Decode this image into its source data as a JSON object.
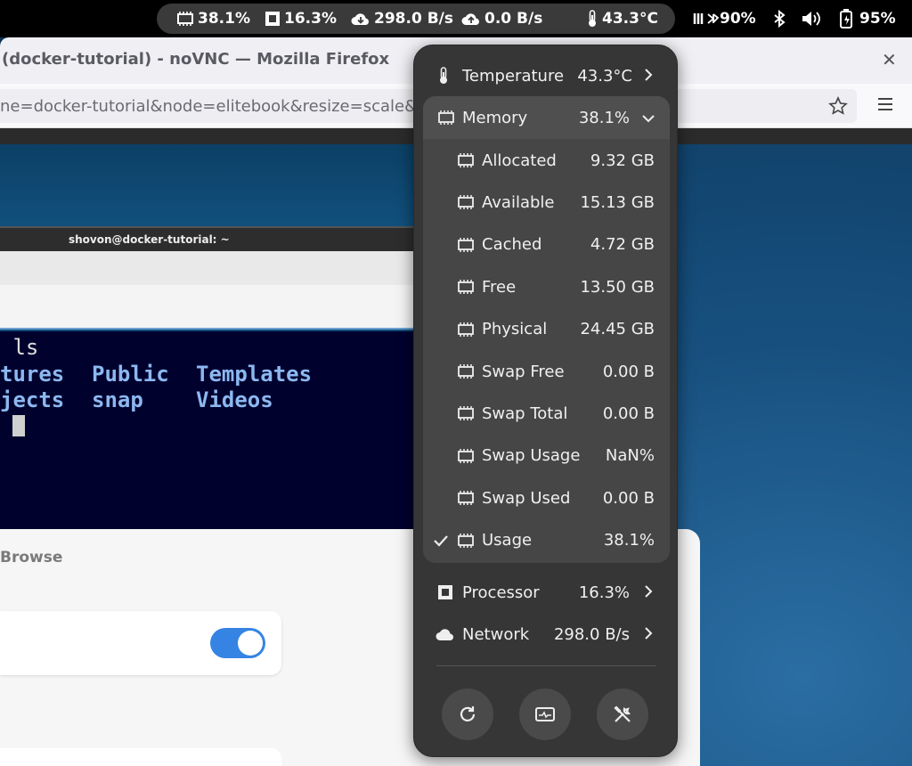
{
  "topbar": {
    "cpu_usage": "38.1%",
    "processor": "16.3%",
    "net_down": "298.0 B/s",
    "net_up": "0.0 B/s",
    "temperature": "43.3°C",
    "wifi": "90%",
    "battery": "95%"
  },
  "firefox": {
    "title": "(docker-tutorial) - noVNC — Mozilla Firefox",
    "url": "ne=docker-tutorial&node=elitebook&resize=scale&c"
  },
  "terminal": {
    "title": "shovon@docker-tutorial: ~",
    "line1": " ls",
    "col1": [
      "tures",
      "jects"
    ],
    "col2": [
      "Public",
      "snap"
    ],
    "col3": [
      "Templates",
      "Videos"
    ]
  },
  "settings": {
    "browse": "Browse"
  },
  "popup": {
    "temperature": {
      "label": "Temperature",
      "value": "43.3°C"
    },
    "memory": {
      "label": "Memory",
      "value": "38.1%"
    },
    "memory_items": [
      {
        "label": "Allocated",
        "value": "9.32 GB"
      },
      {
        "label": "Available",
        "value": "15.13 GB"
      },
      {
        "label": "Cached",
        "value": "4.72 GB"
      },
      {
        "label": "Free",
        "value": "13.50 GB"
      },
      {
        "label": "Physical",
        "value": "24.45 GB"
      },
      {
        "label": "Swap Free",
        "value": "0.00 B"
      },
      {
        "label": "Swap Total",
        "value": "0.00 B"
      },
      {
        "label": "Swap Usage",
        "value": "NaN%"
      },
      {
        "label": "Swap Used",
        "value": "0.00 B"
      },
      {
        "label": "Usage",
        "value": "38.1%",
        "checked": true
      }
    ],
    "processor": {
      "label": "Processor",
      "value": "16.3%"
    },
    "network": {
      "label": "Network",
      "value": "298.0 B/s"
    },
    "buttons": [
      "refresh-icon",
      "system-monitor-icon",
      "preferences-icon"
    ]
  },
  "colors": {
    "accent": "#3584e4",
    "popup_bg": "#363636",
    "submenu_bg": "#464646"
  }
}
